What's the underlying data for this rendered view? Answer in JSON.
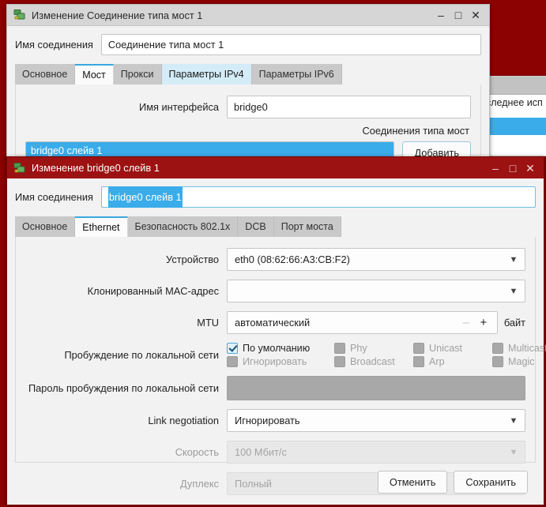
{
  "desktop": {
    "background_color": "#8c0101"
  },
  "background_window": {
    "visible_text": "следнее исп"
  },
  "window1": {
    "title": "Изменение Соединение типа мост 1",
    "icon": "network-bridge-icon",
    "controls": {
      "minimize": "–",
      "maximize": "□",
      "close": "✕"
    },
    "name_label": "Имя соединения",
    "name_value": "Соединение типа мост 1",
    "tabs": [
      {
        "label": "Основное",
        "state": "normal"
      },
      {
        "label": "Мост",
        "state": "active"
      },
      {
        "label": "Прокси",
        "state": "normal"
      },
      {
        "label": "Параметры IPv4",
        "state": "hover"
      },
      {
        "label": "Параметры IPv6",
        "state": "normal"
      }
    ],
    "interface_label": "Имя интерфейса",
    "interface_value": "bridge0",
    "connections_label": "Соединения типа мост",
    "list_items": [
      {
        "label": "bridge0 слейв 1",
        "selected": true
      }
    ],
    "add_button": "Добавить"
  },
  "window2": {
    "title": "Изменение bridge0 слейв 1",
    "icon": "network-bridge-icon",
    "controls": {
      "minimize": "–",
      "maximize": "□",
      "close": "✕"
    },
    "name_label": "Имя соединения",
    "name_value": "bridge0 слейв 1",
    "tabs": [
      {
        "label": "Основное",
        "state": "normal"
      },
      {
        "label": "Ethernet",
        "state": "active"
      },
      {
        "label": "Безопасность 802.1x",
        "state": "normal"
      },
      {
        "label": "DCB",
        "state": "normal"
      },
      {
        "label": "Порт моста",
        "state": "normal"
      }
    ],
    "fields": {
      "device_label": "Устройство",
      "device_value": "eth0 (08:62:66:A3:CB:F2)",
      "cloned_mac_label": "Клонированный MAC-адрес",
      "cloned_mac_value": "",
      "mtu_label": "MTU",
      "mtu_value": "автоматический",
      "mtu_minus": "–",
      "mtu_plus": "+",
      "mtu_unit": "байт",
      "wol_label": "Пробуждение по локальной сети",
      "wol_password_label": "Пароль пробуждения по локальной сети",
      "wol_password_value": "",
      "link_negotiation_label": "Link negotiation",
      "link_negotiation_value": "Игнорировать",
      "speed_label": "Скорость",
      "speed_value": "100 Мбит/с",
      "duplex_label": "Дуплекс",
      "duplex_value": "Полный"
    },
    "wol_options": [
      {
        "label": "По умолчанию",
        "checked": true,
        "enabled": true
      },
      {
        "label": "Phy",
        "checked": false,
        "enabled": false
      },
      {
        "label": "Unicast",
        "checked": false,
        "enabled": false
      },
      {
        "label": "Multicast",
        "checked": false,
        "enabled": false
      },
      {
        "label": "Игнорировать",
        "checked": false,
        "enabled": false
      },
      {
        "label": "Broadcast",
        "checked": false,
        "enabled": false
      },
      {
        "label": "Arp",
        "checked": false,
        "enabled": false
      },
      {
        "label": "Magic",
        "checked": false,
        "enabled": false
      }
    ],
    "cancel_button": "Отменить",
    "save_button": "Сохранить"
  },
  "colors": {
    "desktop_red": "#8c0101",
    "active_titlebar": "#9c1212",
    "inactive_titlebar": "#d6d6d6",
    "selection_blue": "#3bacea",
    "active_tab_underline": "#3aa8e0",
    "hover_tab": "#d4ecf8"
  }
}
